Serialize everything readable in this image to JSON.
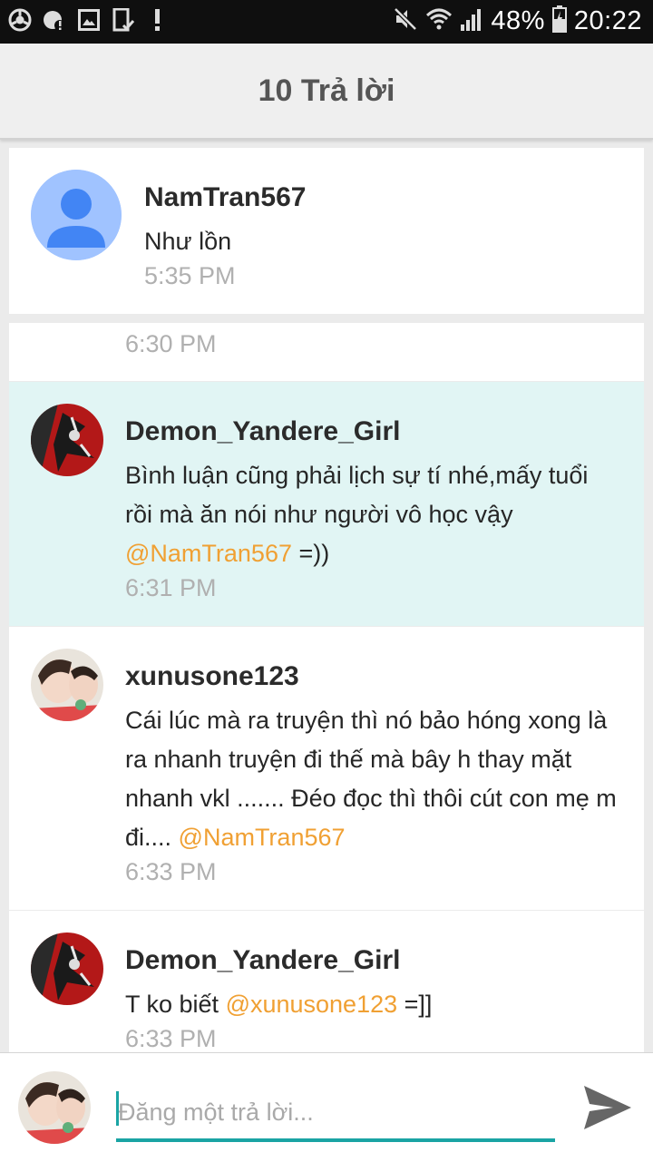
{
  "status_bar": {
    "icons": [
      "chrome-icon",
      "account-alert-icon",
      "image-icon",
      "tablet-check-icon",
      "alert-icon"
    ],
    "right_icons": [
      "mute-icon",
      "wifi-icon",
      "signal-icon",
      "battery-charging-icon"
    ],
    "battery": "48%",
    "time": "20:22"
  },
  "header": {
    "title": "10 Trả lời"
  },
  "comments": [
    {
      "user": "NamTran567",
      "text": "Như lồn",
      "mention": "",
      "after": "",
      "time": "5:35 PM",
      "avatar": "default-avatar"
    },
    {
      "user": "",
      "text": "",
      "time": "6:30 PM"
    },
    {
      "user": "Demon_Yandere_Girl",
      "text": "Bình luận cũng phải lịch sự tí nhé,mấy tuổi rồi mà ăn nói như người vô học vậy ",
      "mention": "@NamTran567",
      "after": " =))",
      "time": "6:31 PM",
      "highlighted": true
    },
    {
      "user": "xunusone123",
      "text": "Cái lúc mà ra truyện thì nó bảo hóng xong là ra nhanh truyện đi thế mà bây h thay mặt nhanh vkl ....... Đéo đọc thì thôi cút con mẹ m đi.... ",
      "mention": "@NamTran567",
      "after": "",
      "time": "6:33 PM"
    },
    {
      "user": "Demon_Yandere_Girl",
      "text": "T ko biết ",
      "mention": "@xunusone123",
      "after": " =]]",
      "time": "6:33 PM"
    }
  ],
  "composer": {
    "placeholder": "Đăng một trả lời..."
  },
  "colors": {
    "accent": "#1aa4a4",
    "mention": "#f0a033",
    "highlight": "#e1f5f4"
  }
}
